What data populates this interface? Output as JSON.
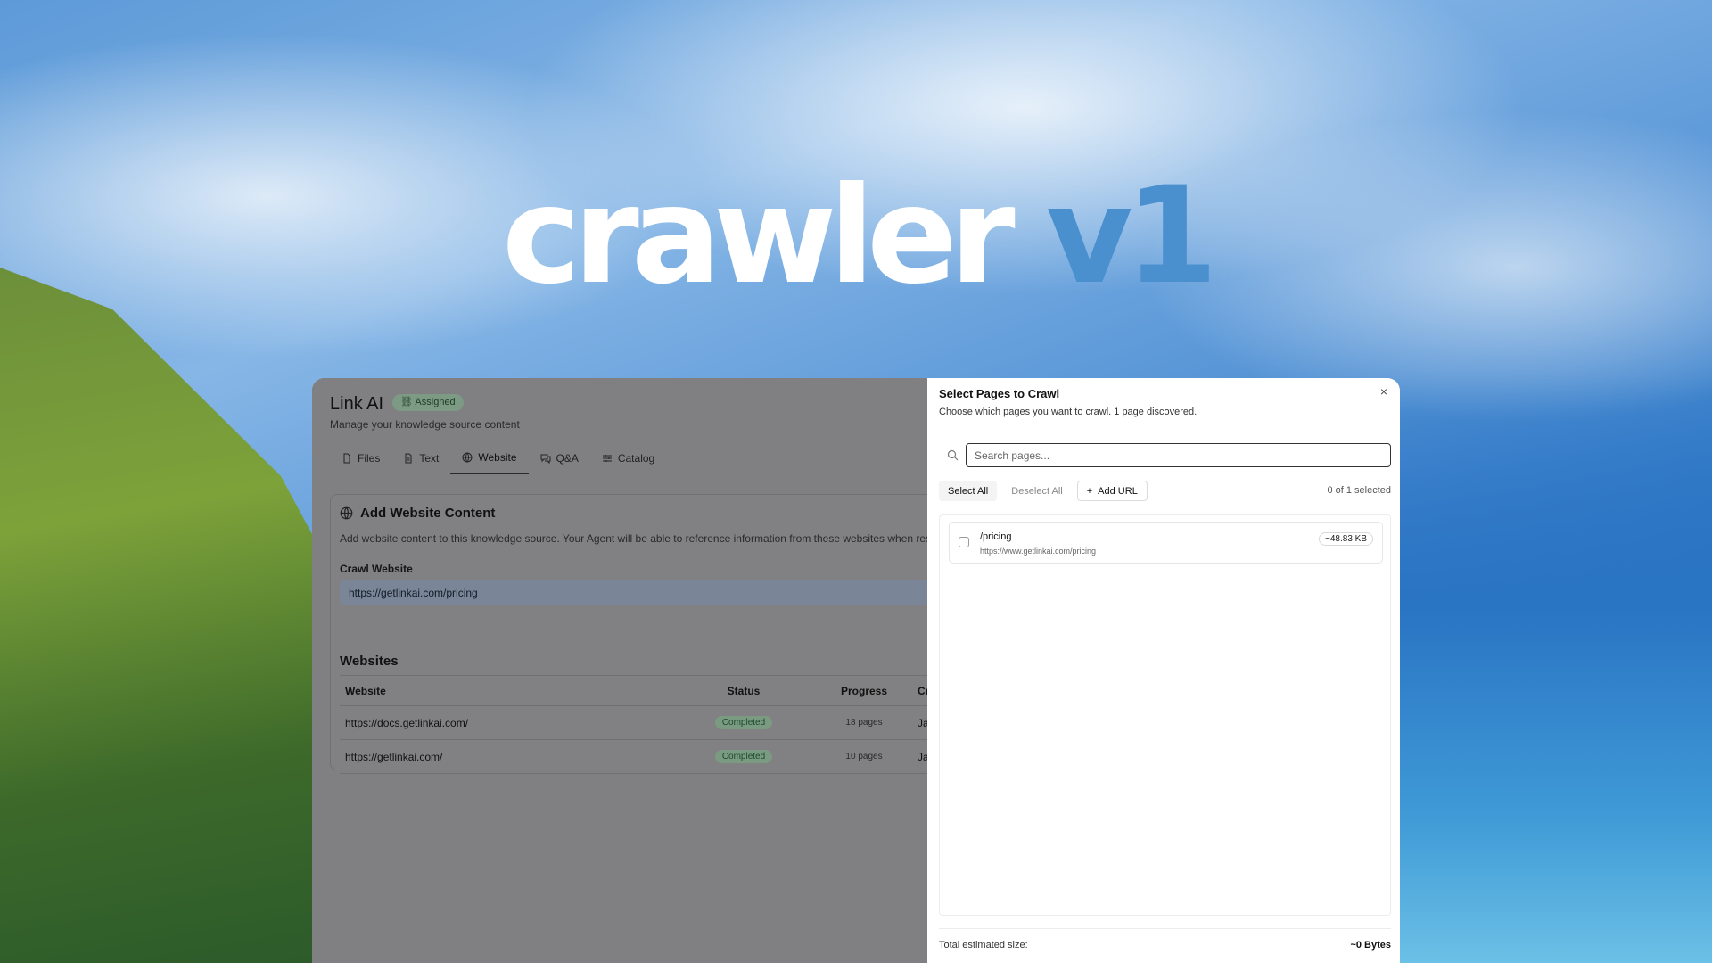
{
  "hero": {
    "word": "crawler",
    "version": "v1"
  },
  "app": {
    "name": "Link AI",
    "badge": "Assigned",
    "subtitle": "Manage your knowledge source content",
    "tabs": [
      {
        "label": "Files",
        "icon": "file-icon"
      },
      {
        "label": "Text",
        "icon": "text-icon"
      },
      {
        "label": "Website",
        "icon": "globe-icon",
        "active": true
      },
      {
        "label": "Q&A",
        "icon": "chat-icon"
      },
      {
        "label": "Catalog",
        "icon": "catalog-icon"
      }
    ]
  },
  "card": {
    "title": "Add Website Content",
    "description": "Add website content to this knowledge source. Your Agent will be able to reference information from these websites when res",
    "crawl_label": "Crawl Website",
    "crawl_value": "https://getlinkai.com/pricing",
    "websites_heading": "Websites",
    "columns": [
      "Website",
      "Status",
      "Progress",
      "Cre"
    ],
    "rows": [
      {
        "website": "https://docs.getlinkai.com/",
        "status": "Completed",
        "progress": "18 pages",
        "created": "Jan"
      },
      {
        "website": "https://getlinkai.com/",
        "status": "Completed",
        "progress": "10 pages",
        "created": "Jan"
      }
    ]
  },
  "panel": {
    "title": "Select Pages to Crawl",
    "close": "×",
    "subtitle": "Choose which pages you want to crawl. 1 page discovered.",
    "search_placeholder": "Search pages...",
    "select_all": "Select All",
    "deselect_all": "Deselect All",
    "add_url": "Add URL",
    "count": "0 of 1 selected",
    "items": [
      {
        "path": "/pricing",
        "url": "https://www.getlinkai.com/pricing",
        "size": "~48.83 KB"
      }
    ],
    "footer_label": "Total estimated size:",
    "footer_value": "~0 Bytes"
  }
}
